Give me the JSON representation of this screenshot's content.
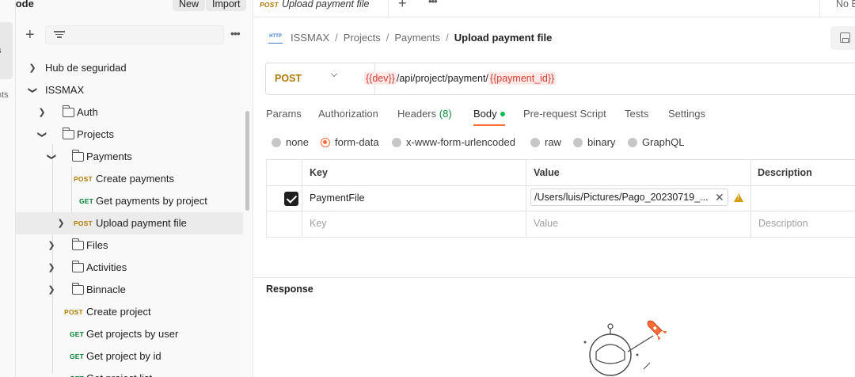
{
  "rail": {
    "label_1": "s",
    "label_2": "nts"
  },
  "sidebar": {
    "workspace_name": "ckcode",
    "new_label": "New",
    "import_label": "Import",
    "items": [
      {
        "kind": "folder",
        "label": "Hub de seguridad",
        "expanded": false
      },
      {
        "kind": "folder",
        "label": "ISSMAX",
        "expanded": true
      },
      {
        "kind": "folder",
        "label": "Auth",
        "expanded": false
      },
      {
        "kind": "folder",
        "label": "Projects",
        "expanded": true
      },
      {
        "kind": "folder",
        "label": "Payments",
        "expanded": true
      },
      {
        "kind": "request",
        "method": "POST",
        "label": "Create payments"
      },
      {
        "kind": "request",
        "method": "GET",
        "label": "Get payments by project"
      },
      {
        "kind": "request",
        "method": "POST",
        "label": "Upload payment file",
        "selected": true
      },
      {
        "kind": "folder",
        "label": "Files",
        "expanded": false
      },
      {
        "kind": "folder",
        "label": "Activities",
        "expanded": false
      },
      {
        "kind": "folder",
        "label": "Binnacle",
        "expanded": false
      },
      {
        "kind": "request",
        "method": "POST",
        "label": "Create project"
      },
      {
        "kind": "request",
        "method": "GET",
        "label": "Get projects by user"
      },
      {
        "kind": "request",
        "method": "GET",
        "label": "Get project by id"
      },
      {
        "kind": "request",
        "method": "GET",
        "label": "Get project list"
      }
    ]
  },
  "tabs": {
    "active": {
      "method": "POST",
      "label": "Upload payment file"
    },
    "environment": "No E"
  },
  "breadcrumb": {
    "icon_text": "HTTP",
    "parts": [
      "ISSMAX",
      "Projects",
      "Payments"
    ],
    "current": "Upload payment file"
  },
  "request": {
    "method": "POST",
    "url_var_1": "{{dev}}",
    "url_path": "/api/project/payment/",
    "url_var_2": "{{payment_id}}"
  },
  "request_tabs": {
    "params": "Params",
    "authorization": "Authorization",
    "headers": "Headers",
    "headers_count": "(8)",
    "body": "Body",
    "prerequest": "Pre-request Script",
    "tests": "Tests",
    "settings": "Settings"
  },
  "body_types": [
    "none",
    "form-data",
    "x-www-form-urlencoded",
    "raw",
    "binary",
    "GraphQL"
  ],
  "form_table": {
    "headers": {
      "key": "Key",
      "value": "Value",
      "description": "Description"
    },
    "row": {
      "key": "PaymentFile",
      "value": "/Users/luis/Pictures/Pago_20230719_..."
    },
    "placeholders": {
      "key": "Key",
      "value": "Value",
      "description": "Description"
    }
  },
  "response": {
    "title": "Response"
  },
  "colors": {
    "accent": "#ff6c37",
    "post": "#ad7a03",
    "get": "#007f31",
    "var": "#d23f31"
  }
}
